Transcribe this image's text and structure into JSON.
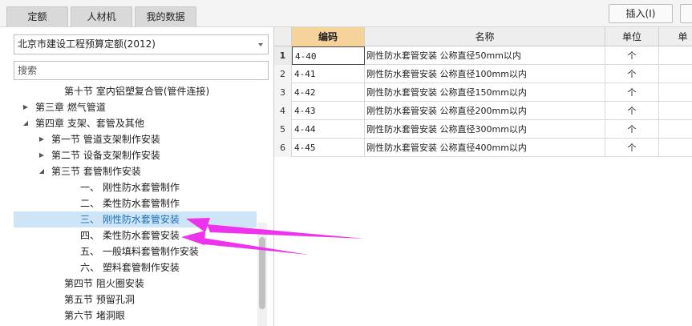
{
  "tabs": [
    {
      "label": "定额",
      "active": true
    },
    {
      "label": "人材机",
      "active": false
    },
    {
      "label": "我的数据",
      "active": false
    }
  ],
  "toolbar": {
    "insert_label": "插入(I)"
  },
  "library_select": {
    "value": "北京市建设工程预算定额(2012)"
  },
  "search": {
    "placeholder": "搜索"
  },
  "tree": [
    {
      "label": "第十节 室内铝塑复合管(管件连接)",
      "arrow": "",
      "selected": false
    },
    {
      "label": "第三章 燃气管道",
      "arrow": "collapsed",
      "selected": false
    },
    {
      "label": "第四章 支架、套管及其他",
      "arrow": "expanded",
      "selected": false
    },
    {
      "label": "第一节 管道支架制作安装",
      "arrow": "collapsed",
      "selected": false
    },
    {
      "label": "第二节 设备支架制作安装",
      "arrow": "collapsed",
      "selected": false
    },
    {
      "label": "第三节 套管制作安装",
      "arrow": "expanded",
      "selected": false
    },
    {
      "label": "一、 刚性防水套管制作",
      "arrow": "",
      "selected": false
    },
    {
      "label": "二、 柔性防水套管制作",
      "arrow": "",
      "selected": false
    },
    {
      "label": "三、 刚性防水套管安装",
      "arrow": "",
      "selected": true
    },
    {
      "label": "四、 柔性防水套管安装",
      "arrow": "",
      "selected": false
    },
    {
      "label": "五、 一般填料套管制作安装",
      "arrow": "",
      "selected": false
    },
    {
      "label": "六、 塑料套管制作安装",
      "arrow": "",
      "selected": false
    },
    {
      "label": "第四节 阻火圈安装",
      "arrow": "",
      "selected": false
    },
    {
      "label": "第五节 预留孔洞",
      "arrow": "",
      "selected": false
    },
    {
      "label": "第六节 堵洞眼",
      "arrow": "",
      "selected": false
    }
  ],
  "grid": {
    "columns": [
      "",
      "编码",
      "名称",
      "单位",
      "单"
    ],
    "rows": [
      {
        "idx": "1",
        "code": "4-40",
        "name": "刚性防水套管安装 公称直径50mm以内",
        "unit": "个"
      },
      {
        "idx": "2",
        "code": "4-41",
        "name": "刚性防水套管安装 公称直径100mm以内",
        "unit": "个"
      },
      {
        "idx": "3",
        "code": "4-42",
        "name": "刚性防水套管安装 公称直径150mm以内",
        "unit": "个"
      },
      {
        "idx": "4",
        "code": "4-43",
        "name": "刚性防水套管安装 公称直径200mm以内",
        "unit": "个"
      },
      {
        "idx": "5",
        "code": "4-44",
        "name": "刚性防水套管安装 公称直径300mm以内",
        "unit": "个"
      },
      {
        "idx": "6",
        "code": "4-45",
        "name": "刚性防水套管安装 公称直径400mm以内",
        "unit": "个"
      }
    ]
  },
  "colors": {
    "accent": "#3d8fe0",
    "selected_row": "#cde5f7",
    "code_header": "#f6d39a",
    "annotation_arrow": "#ee33ee"
  },
  "icons": {
    "tree_collapsed": "▶",
    "tree_expanded": "◢"
  }
}
